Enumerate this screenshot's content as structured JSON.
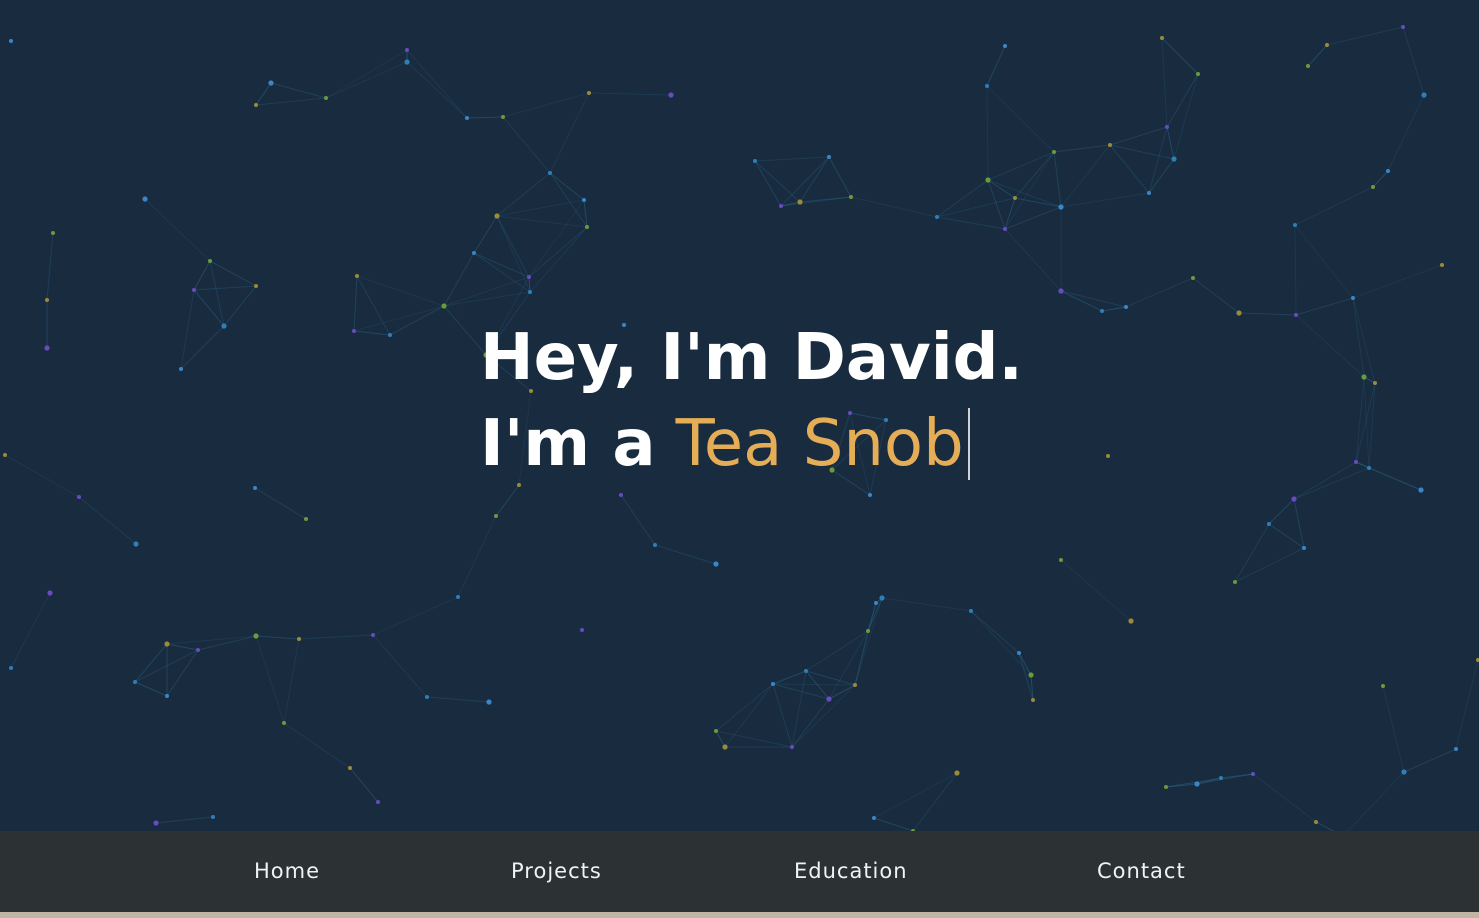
{
  "hero": {
    "greeting": "Hey, I'm David.",
    "role_prefix": "I'm a",
    "role_text": "Tea Snob",
    "accent_color": "#e5ad56",
    "background_color": "#182b3f"
  },
  "nav": {
    "items": [
      {
        "label": "Home"
      },
      {
        "label": "Projects"
      },
      {
        "label": "Education"
      },
      {
        "label": "Contact"
      }
    ],
    "background_color": "#2c3133"
  }
}
